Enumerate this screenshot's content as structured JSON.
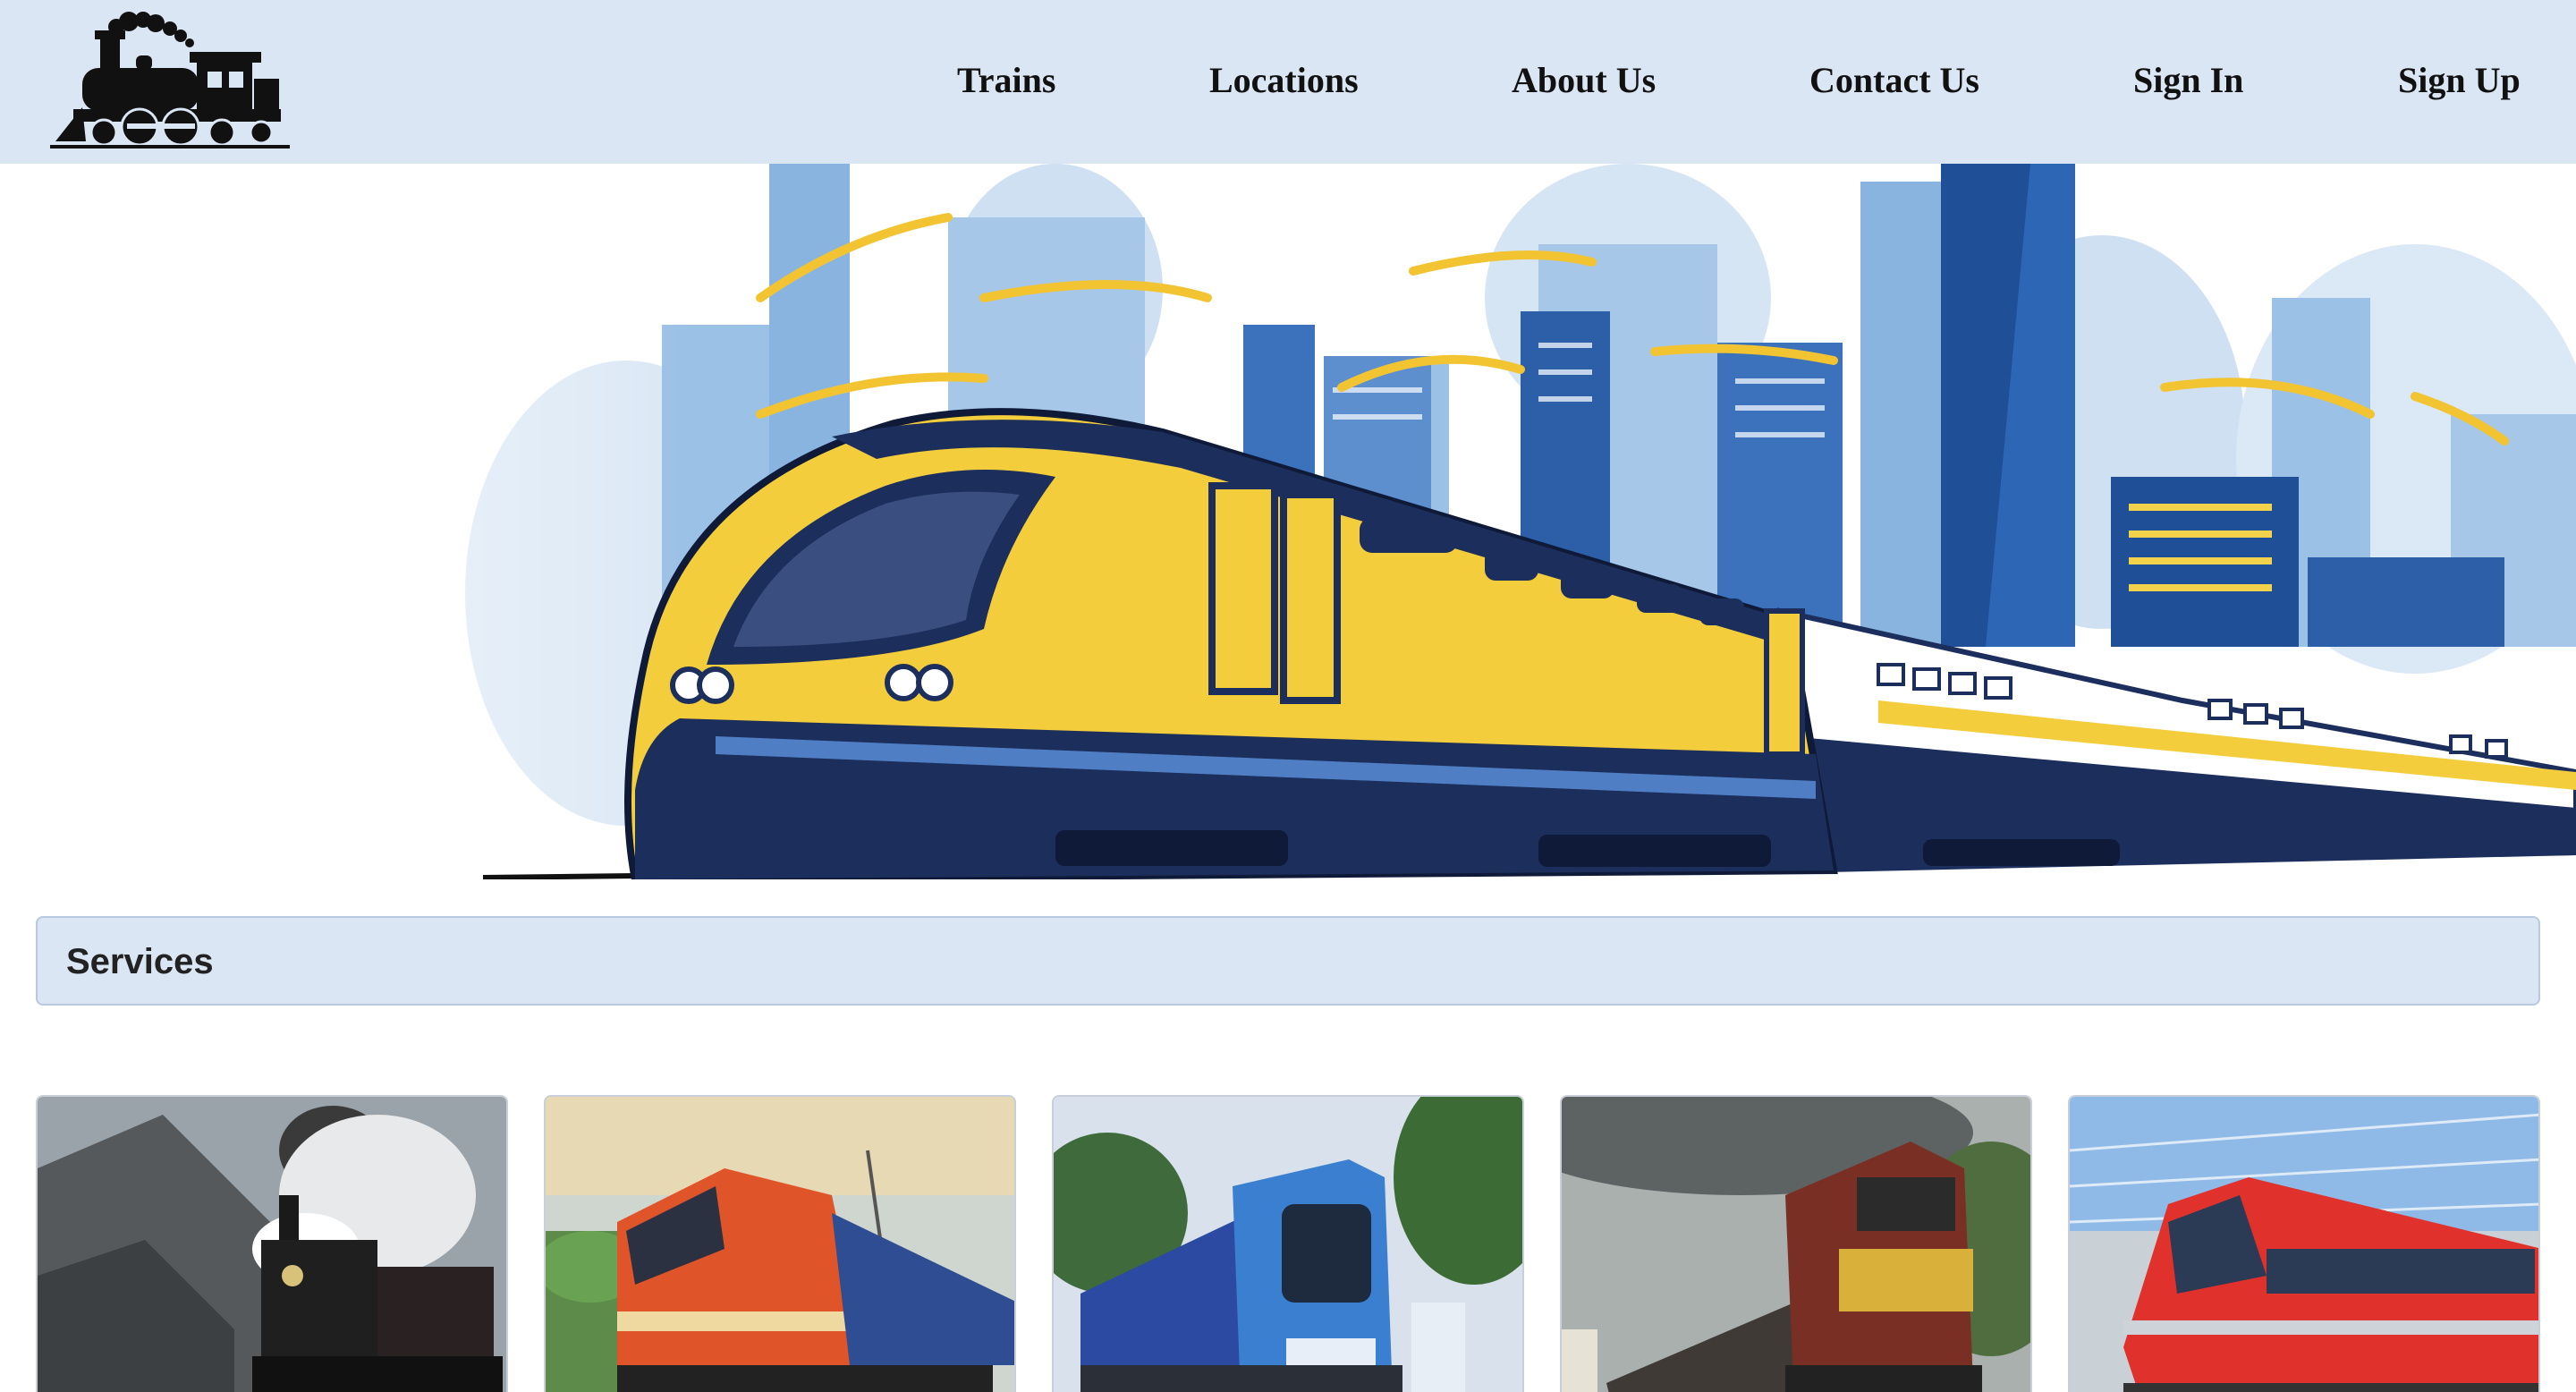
{
  "header": {
    "logo_icon": "steam-locomotive-icon",
    "nav": {
      "trains": "Trains",
      "locations": "Locations",
      "about": "About Us",
      "contact": "Contact Us",
      "sign_in": "Sign In",
      "sign_up": "Sign Up"
    }
  },
  "hero": {
    "image": "yellow-high-speed-train-city-skyline-illustration"
  },
  "services": {
    "title": "Services",
    "cards": [
      {
        "image": "steam-locomotive-mountains"
      },
      {
        "image": "orange-electric-locomotive"
      },
      {
        "image": "blue-passenger-train-forest"
      },
      {
        "image": "freight-diesel-locomotive"
      },
      {
        "image": "red-high-speed-train"
      }
    ]
  },
  "colors": {
    "header_bg": "#dbe6f4",
    "services_bg": "#dbe6f4",
    "train_yellow": "#f4cd3c",
    "train_navy": "#1c2e5c",
    "skyline_blue": "#2f5fa8"
  }
}
